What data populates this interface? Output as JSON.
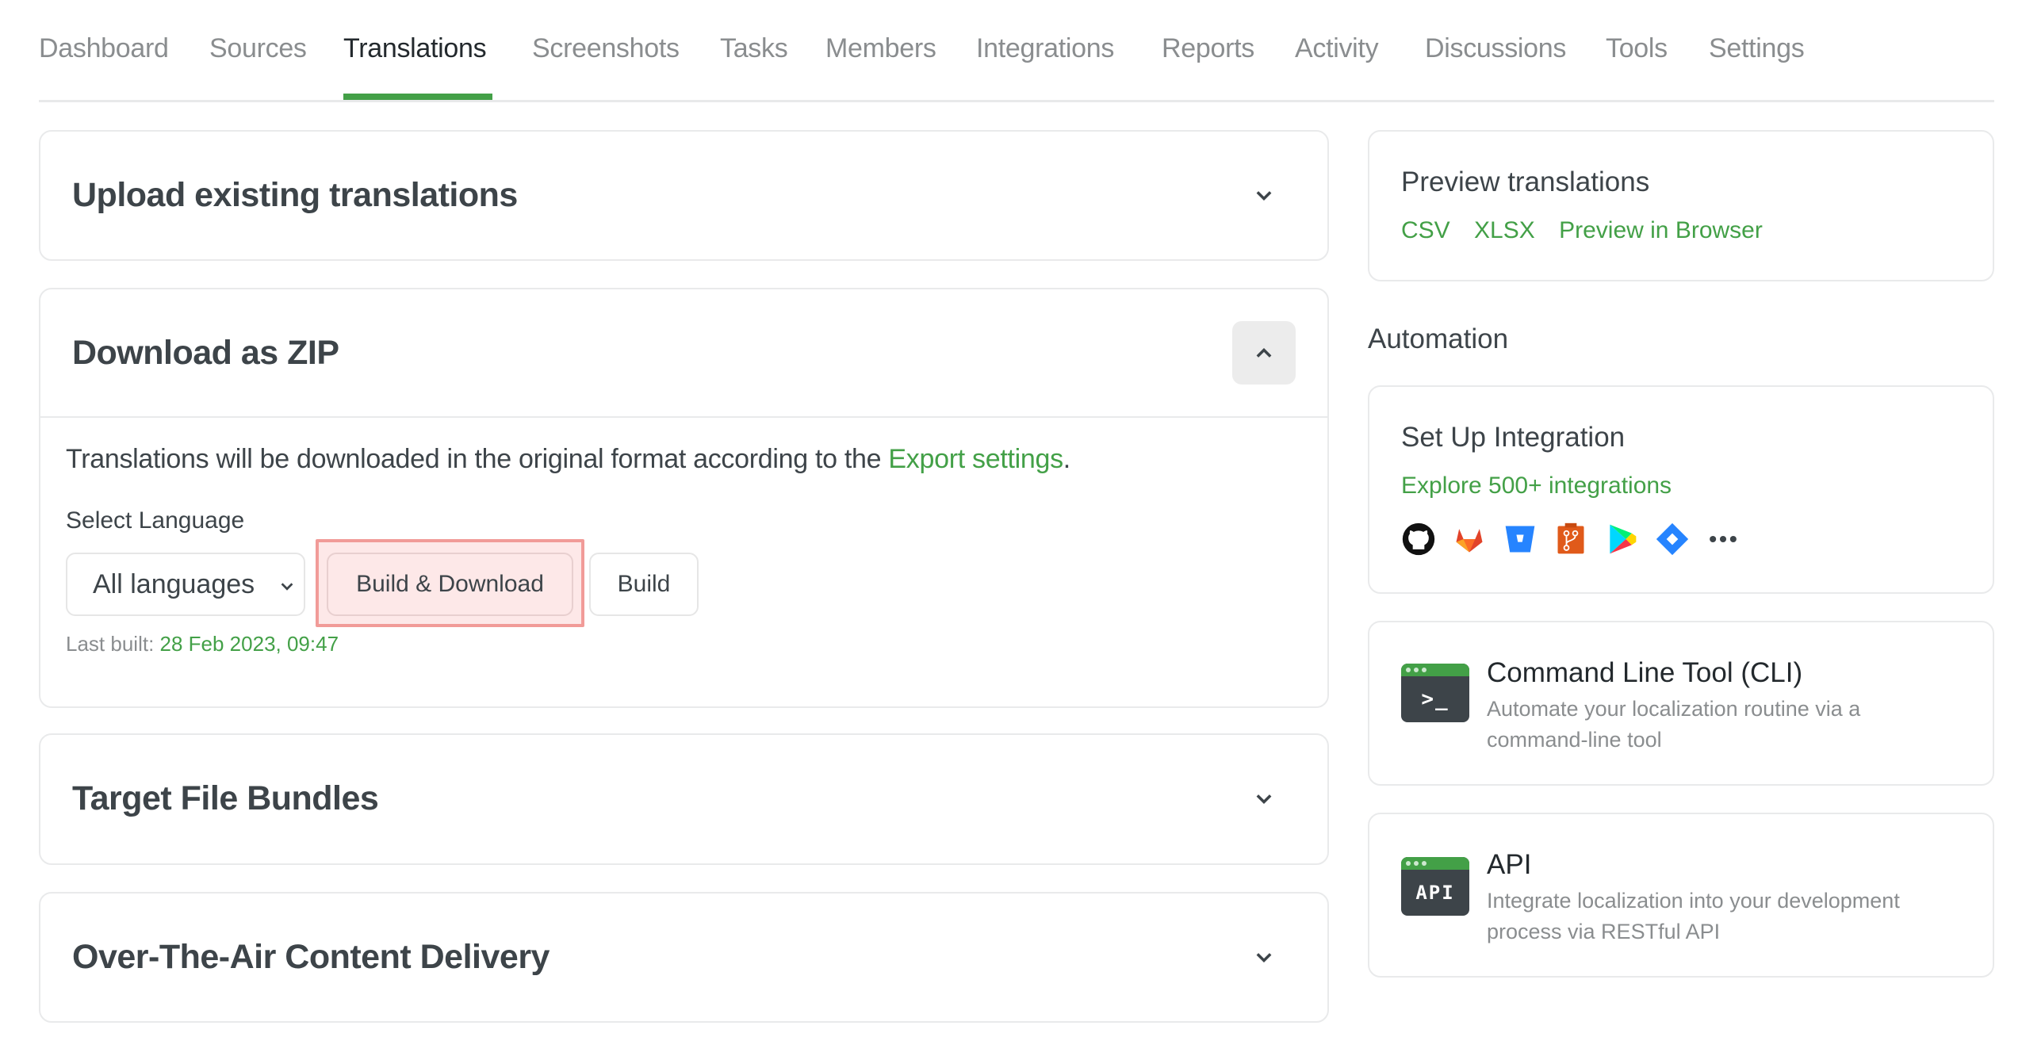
{
  "nav": {
    "tabs": [
      {
        "label": "Dashboard",
        "active": false
      },
      {
        "label": "Sources",
        "active": false
      },
      {
        "label": "Translations",
        "active": true
      },
      {
        "label": "Screenshots",
        "active": false
      },
      {
        "label": "Tasks",
        "active": false
      },
      {
        "label": "Members",
        "active": false
      },
      {
        "label": "Integrations",
        "active": false
      },
      {
        "label": "Reports",
        "active": false
      },
      {
        "label": "Activity",
        "active": false
      },
      {
        "label": "Discussions",
        "active": false
      },
      {
        "label": "Tools",
        "active": false
      },
      {
        "label": "Settings",
        "active": false
      }
    ]
  },
  "sections": {
    "upload": {
      "title": "Upload existing translations",
      "state": "collapsed"
    },
    "download": {
      "title": "Download as ZIP",
      "state": "expanded",
      "description": "Translations will be downloaded in the original format according to the ",
      "description_link": "Export settings",
      "description_end": ".",
      "select_label": "Select Language",
      "select_value": "All languages",
      "build_download_label": "Build & Download",
      "build_label": "Build",
      "last_built_label": "Last built: ",
      "last_built_value": "28 Feb 2023, 09:47"
    },
    "bundles": {
      "title": "Target File Bundles",
      "state": "collapsed"
    },
    "ota": {
      "title": "Over-The-Air Content Delivery",
      "state": "collapsed"
    }
  },
  "sidebar": {
    "preview": {
      "title": "Preview translations",
      "links": [
        "CSV",
        "XLSX",
        "Preview in Browser"
      ]
    },
    "automation_heading": "Automation",
    "integration": {
      "title": "Set Up Integration",
      "link": "Explore 500+ integrations",
      "icons": [
        "github-icon",
        "gitlab-icon",
        "bitbucket-icon",
        "azure-repos-icon",
        "google-play-icon",
        "jira-icon",
        "more-icon"
      ]
    },
    "cli": {
      "title": "Command Line Tool (CLI)",
      "description": "Automate your localization routine via a command-line tool",
      "icon_glyph": ">_"
    },
    "api": {
      "title": "API",
      "description": "Integrate localization into your development process via RESTful API",
      "icon_glyph": "API"
    }
  },
  "colors": {
    "accent": "#43a047",
    "text": "#3d4449",
    "muted": "#8a8d8f",
    "highlight_border": "#f19b98",
    "highlight_fill": "#fde8e8"
  }
}
